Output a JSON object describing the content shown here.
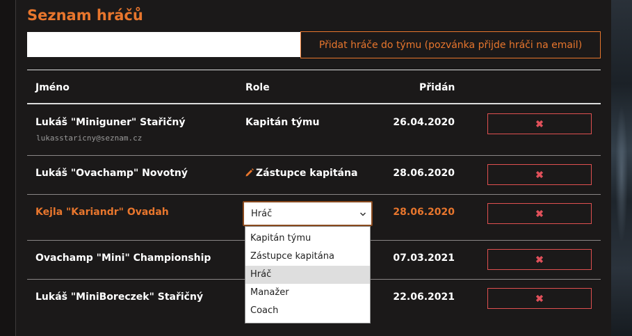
{
  "page": {
    "title": "Seznam hráčů"
  },
  "add_player": {
    "input_value": "",
    "button_label": "Přidat hráče do týmu (pozvánka přijde hráči na email)"
  },
  "table": {
    "headers": {
      "name": "Jméno",
      "role": "Role",
      "added": "Přidán"
    },
    "rows": [
      {
        "name": "Lukáš \"Miniguner\" Stařičný",
        "email": "lukasstaricny@seznam.cz",
        "role": "Kapitán týmu",
        "added": "26.04.2020",
        "remove": "✖"
      },
      {
        "name": "Lukáš \"Ovachamp\" Novotný",
        "email": "",
        "role": "Zástupce kapitána",
        "added": "28.06.2020",
        "remove": "✖"
      },
      {
        "name": "Kejla \"Kariandr\" Ovadah",
        "email": "",
        "role": "Hráč",
        "added": "28.06.2020",
        "remove": "✖"
      },
      {
        "name": "Ovachamp \"Mini\" Championship",
        "email": "",
        "role": "",
        "added": "07.03.2021",
        "remove": "✖"
      },
      {
        "name": "Lukáš \"MiniBoreczek\" Stařičný",
        "email": "",
        "role": "",
        "added": "22.06.2021",
        "remove": "✖"
      }
    ]
  },
  "role_select": {
    "selected": "Hráč",
    "options": [
      "Kapitán týmu",
      "Zástupce kapitána",
      "Hráč",
      "Manažer",
      "Coach"
    ]
  },
  "colors": {
    "accent": "#e8762d",
    "danger": "#e05050",
    "background": "#1b1919"
  },
  "icons": {
    "edit": "pencil-icon",
    "remove": "close-icon",
    "select": "chevron-down-icon"
  }
}
